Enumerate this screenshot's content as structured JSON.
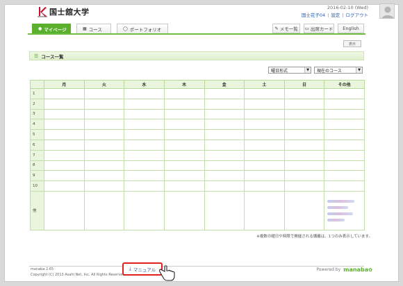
{
  "header": {
    "logo_text": "国士舘大学",
    "date": "2016-02-10 (Wed)",
    "user_name": "国士花子04",
    "settings_link": "設定",
    "logout_link": "ログアウト",
    "separator": "|"
  },
  "nav": {
    "tabs": [
      {
        "label": "マイページ",
        "icon": "person-icon"
      },
      {
        "label": "コース",
        "icon": "course-icon"
      },
      {
        "label": "ポートフォリオ",
        "icon": "portfolio-icon"
      }
    ],
    "memo_label": "メモ一覧",
    "card_label": "出席カード",
    "lang_label": "English"
  },
  "small_button_label": "表示",
  "section": {
    "title": "コース一覧",
    "view_select": "曜日形式",
    "filter_select": "現在のコース"
  },
  "timetable": {
    "headers": [
      "",
      "月",
      "火",
      "水",
      "木",
      "金",
      "土",
      "日",
      "その他"
    ],
    "rows": [
      "1",
      "2",
      "3",
      "4",
      "5",
      "6",
      "7",
      "8",
      "9",
      "10"
    ],
    "other_row_label": "他"
  },
  "note": "※複数の曜日や時限で開催される講義は、1つのみ表示しています。",
  "footer": {
    "version": "manaba 2.65",
    "copyright": "Copyright (C) 2013 Asahi Net, Inc. All Rights Reserved.",
    "powered_by": "Powered by",
    "brand": "manaba",
    "manual_label": "マニュアル"
  },
  "colors": {
    "accent": "#5aaf2d",
    "highlight": "#e0201b",
    "link": "#2a5db0"
  }
}
